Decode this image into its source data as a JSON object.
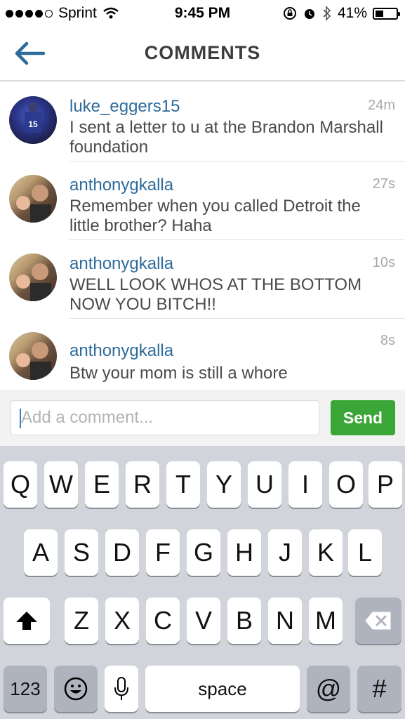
{
  "status_bar": {
    "carrier": "Sprint",
    "time": "9:45 PM",
    "battery_percent": "41%",
    "battery_level": 0.41
  },
  "header": {
    "title": "COMMENTS"
  },
  "comments": [
    {
      "user": "luke_eggers15",
      "time": "24m",
      "text": "I sent a letter to u at the Brandon Marshall foundation"
    },
    {
      "user": "anthonygkalla",
      "time": "27s",
      "text": "Remember when you called Detroit the little brother? Haha"
    },
    {
      "user": "anthonygkalla",
      "time": "10s",
      "text": "WELL LOOK WHOS AT THE BOTTOM NOW YOU BITCH!!"
    },
    {
      "user": "anthonygkalla",
      "time": "8s",
      "text": "Btw your mom is still a whore"
    }
  ],
  "comment_input": {
    "placeholder": "Add a comment...",
    "send_label": "Send"
  },
  "keyboard": {
    "row1": [
      "Q",
      "W",
      "E",
      "R",
      "T",
      "Y",
      "U",
      "I",
      "O",
      "P"
    ],
    "row2": [
      "A",
      "S",
      "D",
      "F",
      "G",
      "H",
      "J",
      "K",
      "L"
    ],
    "row3": [
      "Z",
      "X",
      "C",
      "V",
      "B",
      "N",
      "M"
    ],
    "numbers_label": "123",
    "space_label": "space",
    "at_label": "@",
    "hash_label": "#"
  }
}
